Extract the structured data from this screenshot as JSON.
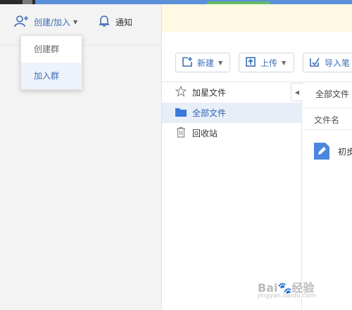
{
  "left_header": {
    "create_join_label": "创建/加入",
    "notice_label": "通知"
  },
  "dropdown": {
    "items": [
      {
        "label": "创建群",
        "hovered": false
      },
      {
        "label": "加入群",
        "hovered": true
      }
    ]
  },
  "toolbar": {
    "new_label": "新建",
    "upload_label": "上传",
    "import_label": "导入笔"
  },
  "nav": {
    "items": [
      {
        "label": "加星文件",
        "icon": "star-icon"
      },
      {
        "label": "全部文件",
        "icon": "folder-icon",
        "active": true
      },
      {
        "label": "回收站",
        "icon": "trash-icon"
      }
    ]
  },
  "content": {
    "breadcrumb": "全部文件",
    "column_filename": "文件名",
    "files": [
      {
        "name": "初步",
        "icon": "note-file-icon"
      }
    ]
  },
  "watermark": {
    "brand": "Bai",
    "brand_suffix": "经验",
    "url": "jingyan.baidu.com"
  },
  "colors": {
    "accent": "#3b6fb6",
    "nav_active_bg": "#e8eef8",
    "notify_bg": "#fff9e3",
    "top_strip": "#5b8fd8",
    "progress_green": "#66bb6a"
  }
}
